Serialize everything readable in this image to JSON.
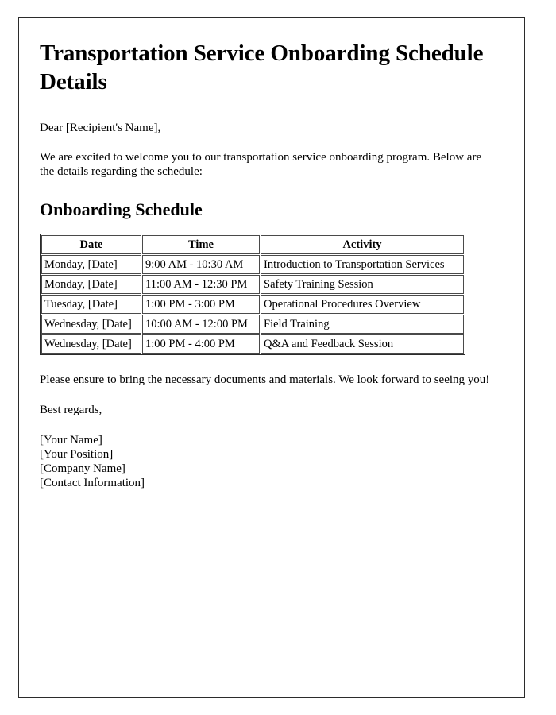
{
  "document": {
    "title": "Transportation Service Onboarding Schedule Details",
    "salutation": "Dear [Recipient's Name],",
    "intro": "We are excited to welcome you to our transportation service onboarding program. Below are the details regarding the schedule:",
    "section_title": "Onboarding Schedule",
    "closing": "Please ensure to bring the necessary documents and materials. We look forward to seeing you!",
    "regards": "Best regards,",
    "signature": {
      "name": "[Your Name]",
      "position": "[Your Position]",
      "company": "[Company Name]",
      "contact": "[Contact Information]"
    }
  },
  "schedule_table": {
    "headers": [
      "Date",
      "Time",
      "Activity"
    ],
    "rows": [
      {
        "date": "Monday, [Date]",
        "time": "9:00 AM - 10:30 AM",
        "activity": "Introduction to Transportation Services"
      },
      {
        "date": "Monday, [Date]",
        "time": "11:00 AM - 12:30 PM",
        "activity": "Safety Training Session"
      },
      {
        "date": "Tuesday, [Date]",
        "time": "1:00 PM - 3:00 PM",
        "activity": "Operational Procedures Overview"
      },
      {
        "date": "Wednesday, [Date]",
        "time": "10:00 AM - 12:00 PM",
        "activity": "Field Training"
      },
      {
        "date": "Wednesday, [Date]",
        "time": "1:00 PM - 4:00 PM",
        "activity": "Q&A and Feedback Session"
      }
    ]
  },
  "colors": {
    "page_background": "#ffffff",
    "text": "#000000",
    "page_border": "#2b2b2b",
    "table_border": "#4a4a4a"
  }
}
